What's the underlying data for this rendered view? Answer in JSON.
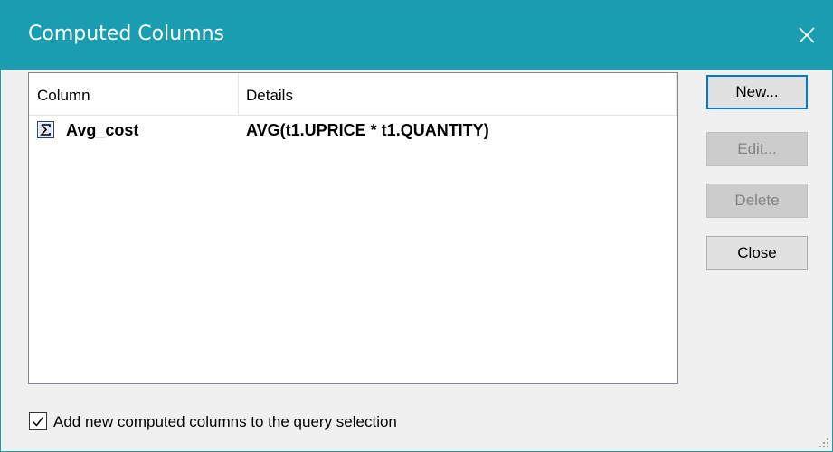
{
  "window": {
    "title": "Computed Columns",
    "accent_color": "#1a9db0",
    "close_icon": "close-icon"
  },
  "list": {
    "columns": [
      "Column",
      "Details"
    ],
    "rows": [
      {
        "icon": "sigma-icon",
        "name": "Avg_cost",
        "details": "AVG(t1.UPRICE * t1.QUANTITY)"
      }
    ]
  },
  "buttons": {
    "new_label": "New...",
    "edit_label": "Edit...",
    "delete_label": "Delete",
    "close_label": "Close"
  },
  "options": {
    "add_to_selection_label": "Add new computed columns to the query selection",
    "add_to_selection_checked": true
  }
}
